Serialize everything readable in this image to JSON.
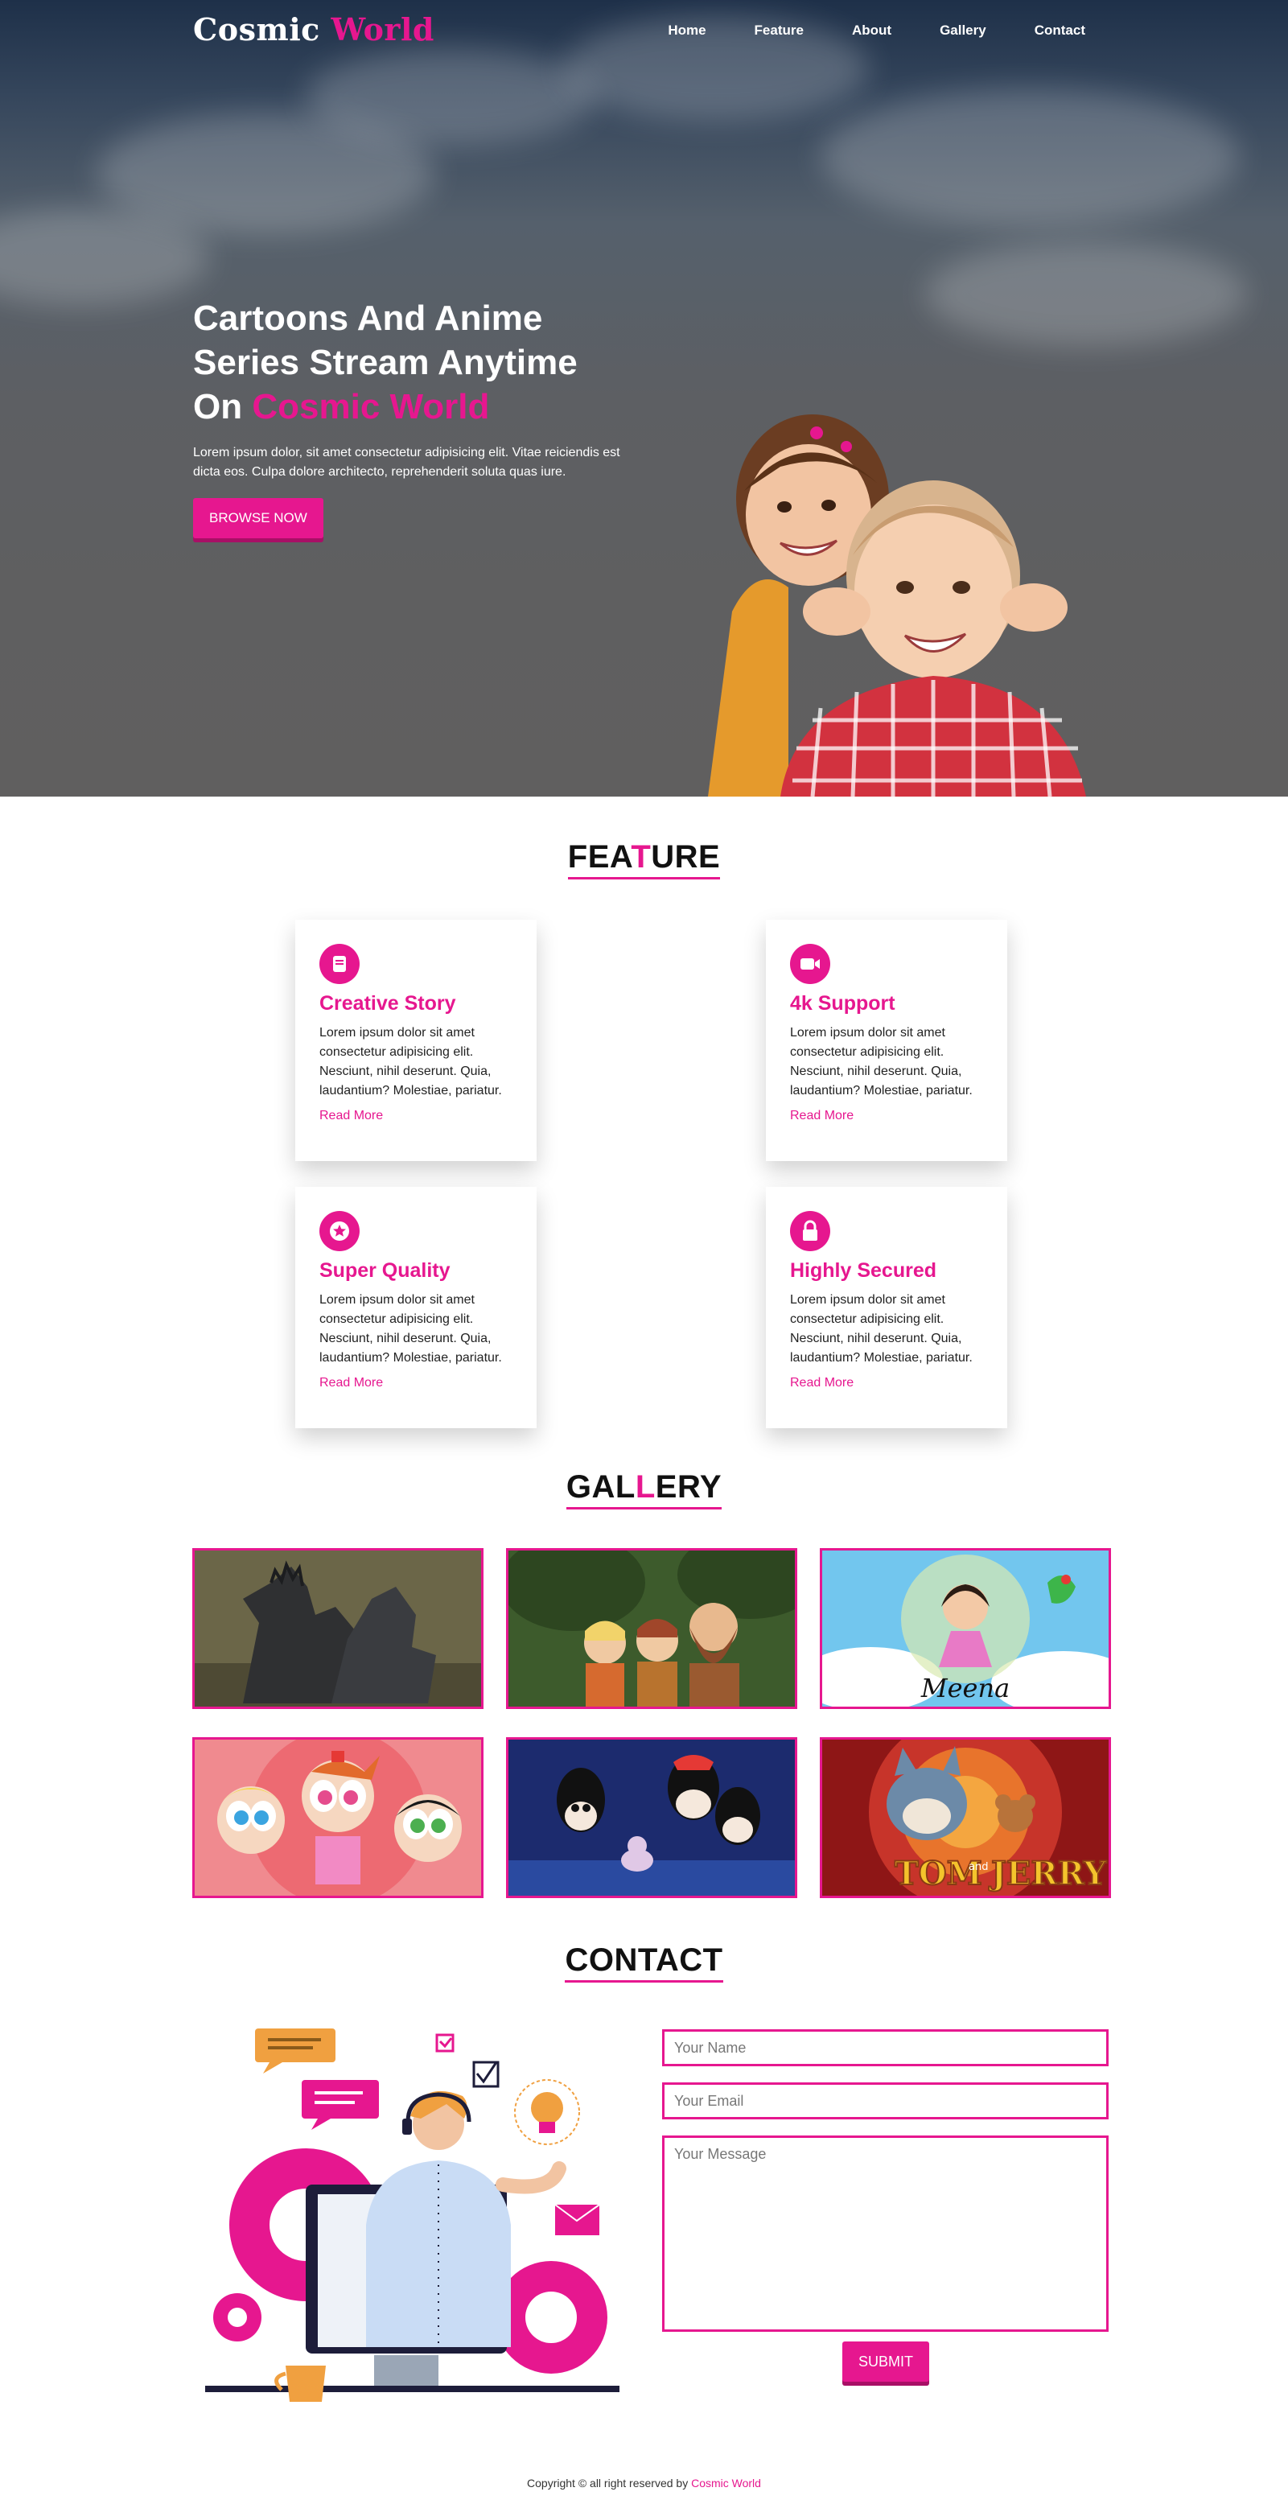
{
  "brand": {
    "part1": "Cosmic",
    "part2": "World"
  },
  "nav": {
    "items": [
      "Home",
      "Feature",
      "About",
      "Gallery",
      "Contact"
    ]
  },
  "hero": {
    "title_line1": "Cartoons And Anime",
    "title_line2": "Series Stream Anytime",
    "title_line3_prefix": "On",
    "title_line3_accent": "Cosmic World",
    "description": "Lorem ipsum dolor, sit amet consectetur adipisicing elit. Vitae reiciendis est dicta eos. Culpa dolore architecto, reprehenderit soluta quas iure.",
    "button": "BROWSE NOW"
  },
  "feature": {
    "title_a": "FEA",
    "title_hl": "T",
    "title_b": "URE",
    "cards": [
      {
        "icon": "book-icon",
        "title": "Creative Story",
        "text": "Lorem ipsum dolor sit amet consectetur adipisicing elit. Nesciunt, nihil deserunt. Quia, laudantium? Molestiae, pariatur.",
        "link": "Read More"
      },
      {
        "icon": "video-camera-icon",
        "title": "4k Support",
        "text": "Lorem ipsum dolor sit amet consectetur adipisicing elit. Nesciunt, nihil deserunt. Quia, laudantium? Molestiae, pariatur.",
        "link": "Read More"
      },
      {
        "icon": "star-icon",
        "title": "Super Quality",
        "text": "Lorem ipsum dolor sit amet consectetur adipisicing elit. Nesciunt, nihil deserunt. Quia, laudantium? Molestiae, pariatur.",
        "link": "Read More"
      },
      {
        "icon": "lock-icon",
        "title": "Highly Secured",
        "text": "Lorem ipsum dolor sit amet consectetur adipisicing elit. Nesciunt, nihil deserunt. Quia, laudantium? Molestiae, pariatur.",
        "link": "Read More"
      }
    ]
  },
  "gallery": {
    "title_a": "GAL",
    "title_hl": "L",
    "title_b": "ERY",
    "meena_caption": "Meena",
    "tomjerry_caption_a": "TOM",
    "tomjerry_caption_and": "and",
    "tomjerry_caption_b": "JERRY"
  },
  "contact": {
    "title": "CONTACT",
    "name_placeholder": "Your Name",
    "email_placeholder": "Your Email",
    "message_placeholder": "Your Message",
    "submit": "SUBMIT"
  },
  "footer": {
    "text": "Copyright © all right reserved by",
    "brand": "Cosmic World"
  },
  "colors": {
    "accent": "#e6178f",
    "accent_dark": "#a80f66",
    "hero_top": "#1e3049",
    "hero_bottom": "#605f5f"
  }
}
